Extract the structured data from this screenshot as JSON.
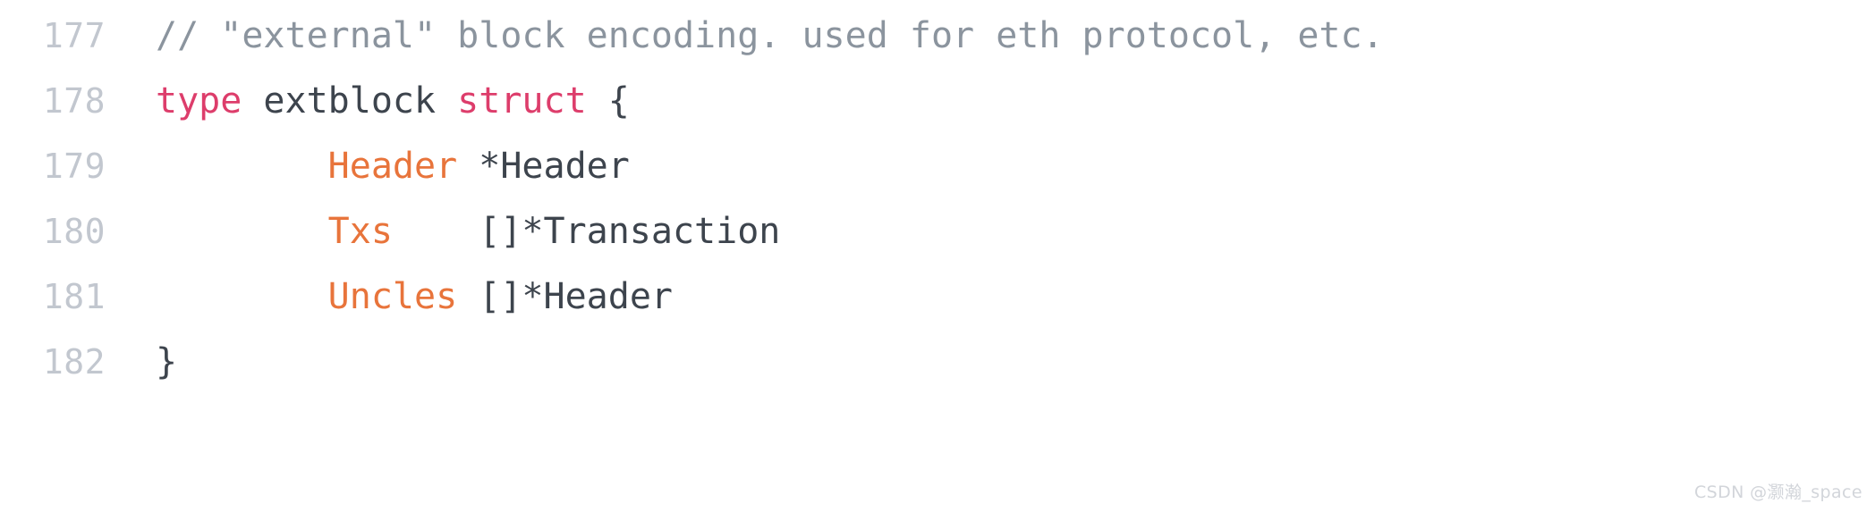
{
  "editor": {
    "language": "go",
    "background_color": "#ffffff",
    "gutter_color": "#c2c7cf",
    "colors": {
      "comment": "#8b949e",
      "keyword": "#dd3d6b",
      "field": "#e8743b",
      "plain": "#3d444d"
    },
    "lines": [
      {
        "number": "177",
        "text": "// \"external\" block encoding. used for eth protocol, etc.",
        "tokens": [
          {
            "kind": "comment",
            "text": "// \"external\" block encoding. used for eth protocol, etc."
          }
        ]
      },
      {
        "number": "178",
        "text": "type extblock struct {",
        "tokens": [
          {
            "kind": "keyword",
            "text": "type"
          },
          {
            "kind": "plain",
            "text": " extblock "
          },
          {
            "kind": "keyword",
            "text": "struct"
          },
          {
            "kind": "plain",
            "text": " {"
          }
        ]
      },
      {
        "number": "179",
        "text": "        Header *Header",
        "tokens": [
          {
            "kind": "plain",
            "text": "        "
          },
          {
            "kind": "field",
            "text": "Header"
          },
          {
            "kind": "plain",
            "text": " *Header"
          }
        ]
      },
      {
        "number": "180",
        "text": "        Txs    []*Transaction",
        "tokens": [
          {
            "kind": "plain",
            "text": "        "
          },
          {
            "kind": "field",
            "text": "Txs"
          },
          {
            "kind": "plain",
            "text": "    []*Transaction"
          }
        ]
      },
      {
        "number": "181",
        "text": "        Uncles []*Header",
        "tokens": [
          {
            "kind": "plain",
            "text": "        "
          },
          {
            "kind": "field",
            "text": "Uncles"
          },
          {
            "kind": "plain",
            "text": " []*Header"
          }
        ]
      },
      {
        "number": "182",
        "text": "}",
        "tokens": [
          {
            "kind": "plain",
            "text": "}"
          }
        ]
      }
    ]
  },
  "watermark": {
    "text": "CSDN @灏瀚_space"
  }
}
